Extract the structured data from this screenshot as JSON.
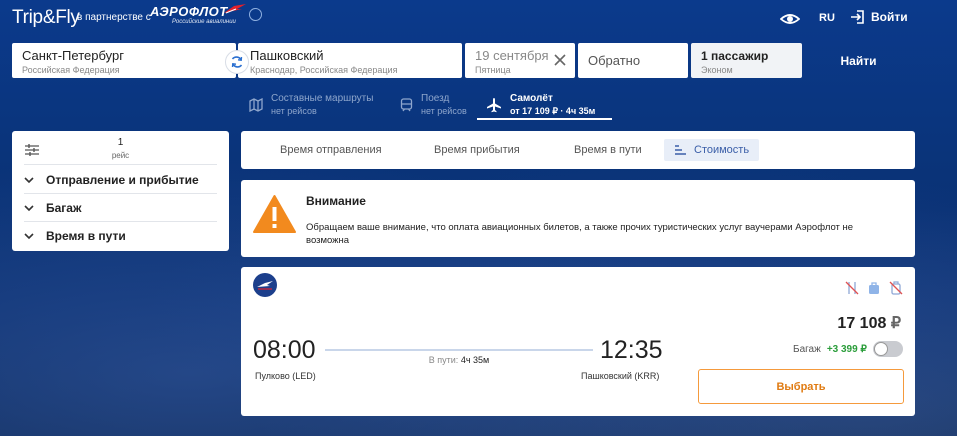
{
  "header": {
    "logo": "Trip&Fly",
    "partner_text": "в партнерстве с",
    "partner_brand": "АЭРОФЛОТ",
    "partner_brand_sub": "Российские авиалинии",
    "lang": "RU",
    "login": "Войти"
  },
  "search": {
    "from_city": "Санкт-Петербург",
    "from_country": "Российская Федерация",
    "to_city": "Пашковский",
    "to_region": "Краснодар, Российская Федерация",
    "date": "19 сентября",
    "weekday": "Пятница",
    "return_placeholder": "Обратно",
    "passengers": "1 пассажир",
    "class": "Эконом",
    "search_button": "Найти"
  },
  "transport_tabs": [
    {
      "label": "Составные маршруты",
      "sub": "нет рейсов",
      "icon": "map-icon"
    },
    {
      "label": "Поезд",
      "sub": "нет рейсов",
      "icon": "train-icon"
    },
    {
      "label": "Самолёт",
      "sub": "от 17 109 ₽ · 4ч 35м",
      "icon": "plane-icon"
    }
  ],
  "filters": {
    "stops_value": "1",
    "stops_label": "рейс",
    "items": [
      "Отправление и прибытие",
      "Багаж",
      "Время в пути"
    ]
  },
  "sort": {
    "options": [
      "Время отправления",
      "Время прибытия",
      "Время в пути",
      "Стоимость"
    ],
    "active": "Стоимость"
  },
  "alert": {
    "title": "Внимание",
    "text": "Обращаем ваше внимание, что оплата авиационных билетов, а также прочих туристических услуг ваучерами Аэрофлот не возможна"
  },
  "ticket": {
    "dep_time": "08:00",
    "dep_airport": "Пулково (LED)",
    "arr_time": "12:35",
    "arr_airport": "Пашковский (KRR)",
    "duration_label": "В пути:",
    "duration": "4ч 35м",
    "price": "17 108",
    "currency": "₽",
    "baggage_label": "Багаж",
    "baggage_price": "+3 399 ₽",
    "select_button": "Выбрать"
  },
  "colors": {
    "header_bg": "#0b3a8c",
    "accent_orange": "#f59a3c",
    "alert_orange": "#f28a1e",
    "active_sort_bg": "#e8eef8",
    "green": "#2a9d3a"
  }
}
